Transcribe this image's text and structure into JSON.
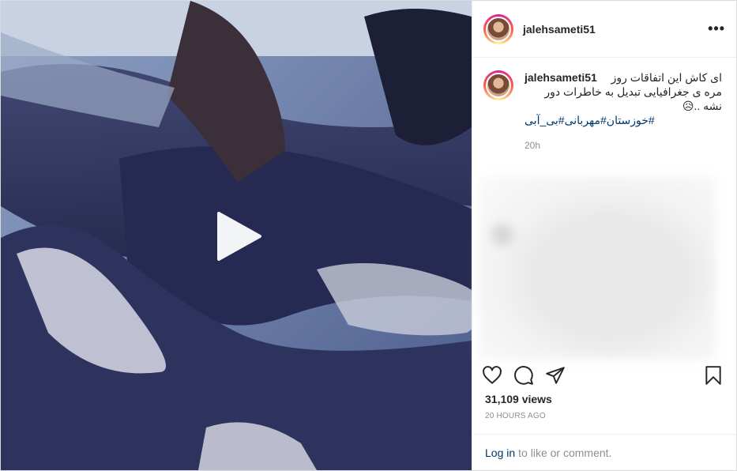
{
  "post": {
    "username": "jalehsameti51",
    "more_label": "•••",
    "caption": {
      "username": "jalehsameti51",
      "text": "ای کاش این اتفاقات روز مره ی جغرافیایی تبدیل به خاطرات دور نشه ..😥",
      "hashtags": "#خوزستان#مهربانی#بی_آبی",
      "time_ago": "20h"
    },
    "views": "31,109 views",
    "posted_ago": "20 HOURS AGO",
    "login": {
      "link_label": "Log in",
      "suffix": "to like or comment."
    }
  },
  "icons": {
    "play": "play-icon",
    "more": "more-options-icon",
    "like": "heart-icon",
    "comment": "comment-icon",
    "share": "share-icon",
    "save": "bookmark-icon"
  },
  "colors": {
    "link": "#00376b",
    "muted": "#8e8e8e",
    "text": "#262626",
    "video_tint": "#2b2f56"
  }
}
